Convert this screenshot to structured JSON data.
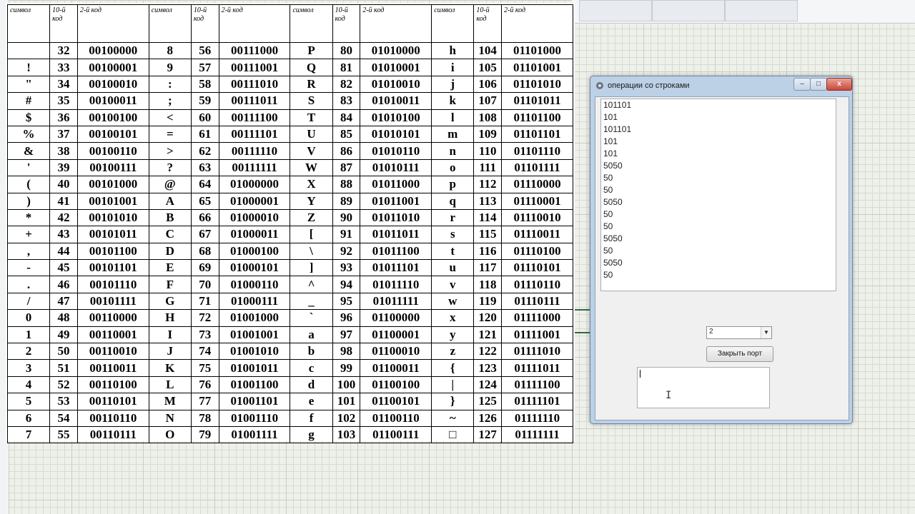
{
  "ascii_table": {
    "headers": [
      "символ",
      "10-й код",
      "2-й код",
      "символ",
      "10-й код",
      "2-й код",
      "символ",
      "10-й код",
      "2-й код",
      "символ",
      "10-й код",
      "2-й код"
    ],
    "rows": [
      [
        "",
        "32",
        "00100000",
        "8",
        "56",
        "00111000",
        "P",
        "80",
        "01010000",
        "h",
        "104",
        "01101000"
      ],
      [
        "!",
        "33",
        "00100001",
        "9",
        "57",
        "00111001",
        "Q",
        "81",
        "01010001",
        "i",
        "105",
        "01101001"
      ],
      [
        "\"",
        "34",
        "00100010",
        ":",
        "58",
        "00111010",
        "R",
        "82",
        "01010010",
        "j",
        "106",
        "01101010"
      ],
      [
        "#",
        "35",
        "00100011",
        ";",
        "59",
        "00111011",
        "S",
        "83",
        "01010011",
        "k",
        "107",
        "01101011"
      ],
      [
        "$",
        "36",
        "00100100",
        "<",
        "60",
        "00111100",
        "T",
        "84",
        "01010100",
        "l",
        "108",
        "01101100"
      ],
      [
        "%",
        "37",
        "00100101",
        "=",
        "61",
        "00111101",
        "U",
        "85",
        "01010101",
        "m",
        "109",
        "01101101"
      ],
      [
        "&",
        "38",
        "00100110",
        ">",
        "62",
        "00111110",
        "V",
        "86",
        "01010110",
        "n",
        "110",
        "01101110"
      ],
      [
        "'",
        "39",
        "00100111",
        "?",
        "63",
        "00111111",
        "W",
        "87",
        "01010111",
        "o",
        "111",
        "01101111"
      ],
      [
        "(",
        "40",
        "00101000",
        "@",
        "64",
        "01000000",
        "X",
        "88",
        "01011000",
        "p",
        "112",
        "01110000"
      ],
      [
        ")",
        "41",
        "00101001",
        "A",
        "65",
        "01000001",
        "Y",
        "89",
        "01011001",
        "q",
        "113",
        "01110001"
      ],
      [
        "*",
        "42",
        "00101010",
        "B",
        "66",
        "01000010",
        "Z",
        "90",
        "01011010",
        "r",
        "114",
        "01110010"
      ],
      [
        "+",
        "43",
        "00101011",
        "C",
        "67",
        "01000011",
        "[",
        "91",
        "01011011",
        "s",
        "115",
        "01110011"
      ],
      [
        ",",
        "44",
        "00101100",
        "D",
        "68",
        "01000100",
        "\\",
        "92",
        "01011100",
        "t",
        "116",
        "01110100"
      ],
      [
        "-",
        "45",
        "00101101",
        "E",
        "69",
        "01000101",
        "]",
        "93",
        "01011101",
        "u",
        "117",
        "01110101"
      ],
      [
        ".",
        "46",
        "00101110",
        "F",
        "70",
        "01000110",
        "^",
        "94",
        "01011110",
        "v",
        "118",
        "01110110"
      ],
      [
        "/",
        "47",
        "00101111",
        "G",
        "71",
        "01000111",
        "_",
        "95",
        "01011111",
        "w",
        "119",
        "01110111"
      ],
      [
        "0",
        "48",
        "00110000",
        "H",
        "72",
        "01001000",
        "`",
        "96",
        "01100000",
        "x",
        "120",
        "01111000"
      ],
      [
        "1",
        "49",
        "00110001",
        "I",
        "73",
        "01001001",
        "a",
        "97",
        "01100001",
        "y",
        "121",
        "01111001"
      ],
      [
        "2",
        "50",
        "00110010",
        "J",
        "74",
        "01001010",
        "b",
        "98",
        "01100010",
        "z",
        "122",
        "01111010"
      ],
      [
        "3",
        "51",
        "00110011",
        "K",
        "75",
        "01001011",
        "c",
        "99",
        "01100011",
        "{",
        "123",
        "01111011"
      ],
      [
        "4",
        "52",
        "00110100",
        "L",
        "76",
        "01001100",
        "d",
        "100",
        "01100100",
        "|",
        "124",
        "01111100"
      ],
      [
        "5",
        "53",
        "00110101",
        "M",
        "77",
        "01001101",
        "e",
        "101",
        "01100101",
        "}",
        "125",
        "01111101"
      ],
      [
        "6",
        "54",
        "00110110",
        "N",
        "78",
        "01001110",
        "f",
        "102",
        "01100110",
        "~",
        "126",
        "01111110"
      ],
      [
        "7",
        "55",
        "00110111",
        "O",
        "79",
        "01001111",
        "g",
        "103",
        "01100111",
        "□",
        "127",
        "01111111"
      ]
    ]
  },
  "dialog": {
    "title": "операции со строками",
    "icon": "app-icon",
    "buttons": {
      "minimize": "–",
      "maximize": "□",
      "close": "x"
    },
    "output_lines": [
      "101101",
      "101",
      "101101",
      "101",
      "101",
      "5050",
      "50",
      "50",
      "5050",
      "50",
      "50",
      "5050",
      "50",
      "5050",
      "50"
    ],
    "port_select": {
      "value": "2",
      "arrow": "▼"
    },
    "close_port_button": "Закрыть порт",
    "input_value": "",
    "ibeam": "I"
  },
  "colors": {
    "dialog_frame": "#bcd0e6",
    "wire": "#2f6b3f",
    "grid": "#d7dbd0"
  }
}
